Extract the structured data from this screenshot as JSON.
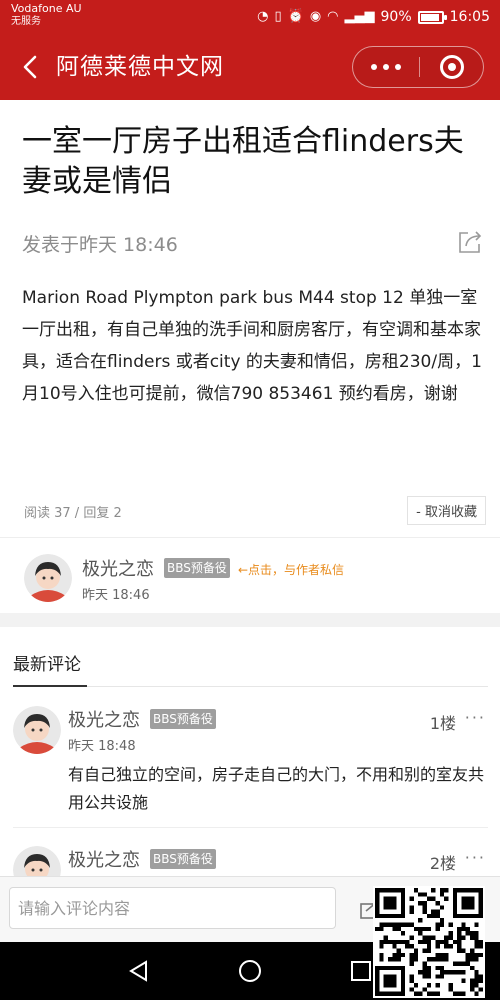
{
  "status_bar": {
    "carrier": "Vodafone AU",
    "carrier_sub": "无服务",
    "battery": "90%",
    "battery_level": 0.9,
    "time": "16:05"
  },
  "header": {
    "title": "阿德莱德中文网",
    "back_icon": "back-arrow-icon",
    "more_icon": "more-dots-icon",
    "close_icon": "close-miniprogram-icon"
  },
  "post": {
    "title": "一室一厅房子出租适合flinders夫妻或是情侣",
    "time": "发表于昨天 18:46",
    "body": "Marion Road Plympton park bus M44 stop 12 单独一室一厅出租，有自己单独的洗手间和厨房客厅，有空调和基本家具，适合在flinders 或者city 的夫妻和情侣，房租230/周，1月10号入住也可提前，微信790 853461 预约看房，谢谢",
    "stats": "阅读 37 / 回复 2",
    "unfavorite_label": "- 取消收藏"
  },
  "author": {
    "name": "极光之恋",
    "badge": "BBS预备役",
    "dm_tip": "←点击，与作者私信",
    "time": "昨天 18:46"
  },
  "comments": {
    "title": "最新评论",
    "items": [
      {
        "name": "极光之恋",
        "badge": "BBS预备役",
        "time": "昨天 18:48",
        "floor": "1楼",
        "more": "···",
        "text": "有自己独立的空间，房子走自己的大门，不用和别的室友共用公共设施"
      },
      {
        "name": "极光之恋",
        "badge": "BBS预备役",
        "floor": "2楼",
        "more": "···"
      }
    ]
  },
  "input": {
    "placeholder": "请输入评论内容"
  },
  "colors": {
    "brand_red": "#c41d1b",
    "badge_gray": "#9e9e9e",
    "tip_orange": "#e88a1a"
  }
}
